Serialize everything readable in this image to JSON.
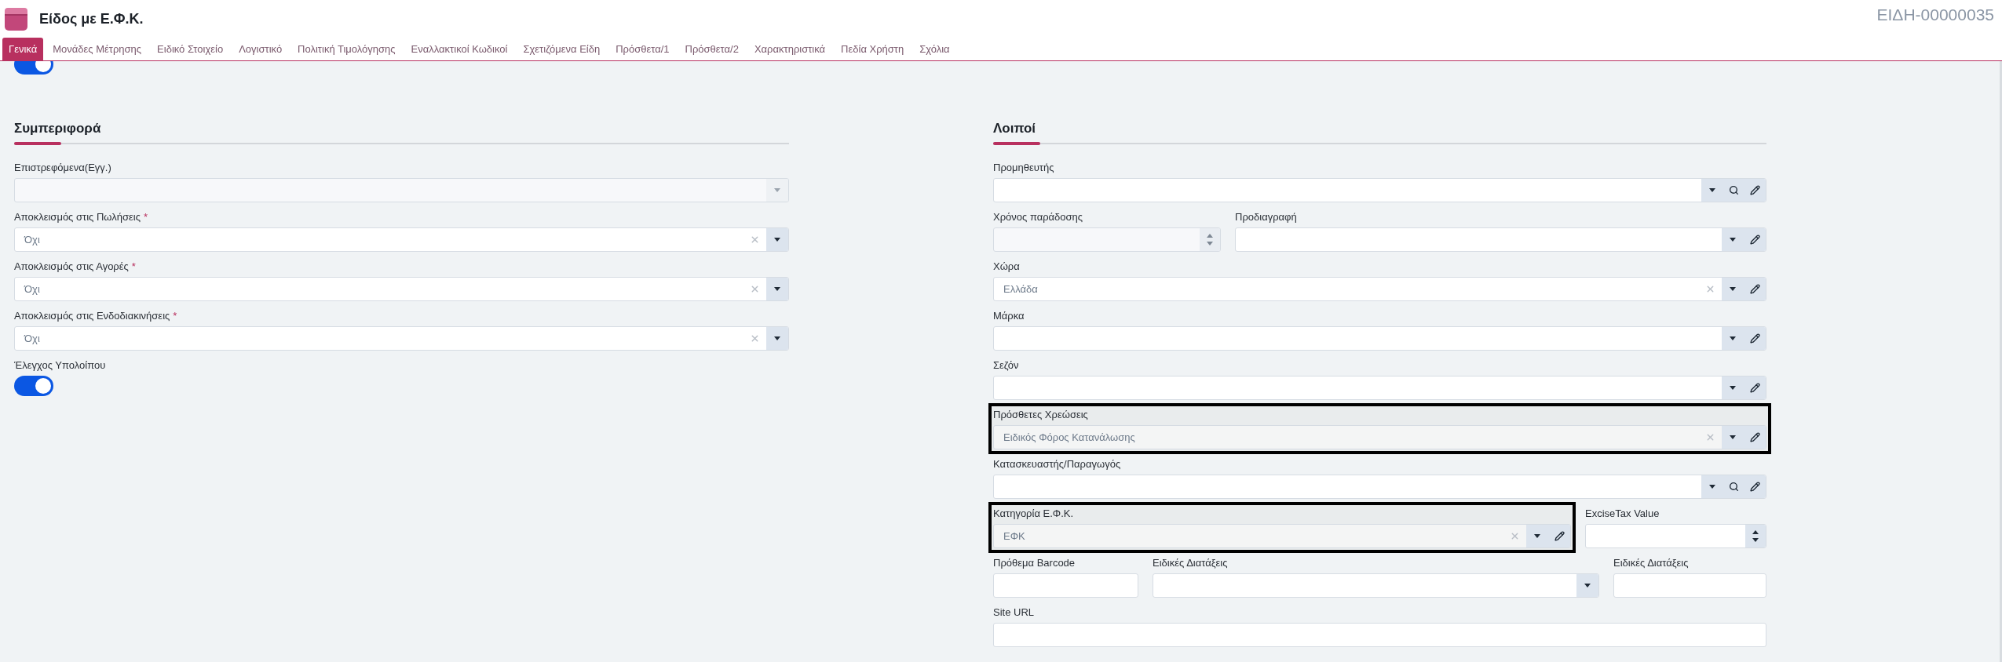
{
  "header": {
    "title": "Είδος με Ε.Φ.Κ.",
    "record_code": "ΕΙΔΗ-00000035"
  },
  "tabs": [
    {
      "label": "Γενικά",
      "selected": true
    },
    {
      "label": "Μονάδες Μέτρησης",
      "selected": false
    },
    {
      "label": "Ειδικό Στοιχείο",
      "selected": false
    },
    {
      "label": "Λογιστικό",
      "selected": false
    },
    {
      "label": "Πολιτική Τιμολόγησης",
      "selected": false
    },
    {
      "label": "Εναλλακτικοί Κωδικοί",
      "selected": false
    },
    {
      "label": "Σχετιζόμενα Είδη",
      "selected": false
    },
    {
      "label": "Πρόσθετα/1",
      "selected": false
    },
    {
      "label": "Πρόσθετα/2",
      "selected": false
    },
    {
      "label": "Χαρακτηριστικά",
      "selected": false
    },
    {
      "label": "Πεδία Χρήστη",
      "selected": false
    },
    {
      "label": "Σχόλια",
      "selected": false
    }
  ],
  "top_toggle": {
    "on": true
  },
  "left_section": {
    "title": "Συμπεριφορά",
    "fields": [
      {
        "kind": "select",
        "label": "Επιστρεφόμενα(Εγγ.)",
        "disabled": true
      },
      {
        "kind": "select",
        "label": "Αποκλεισμός στις Πωλήσεις",
        "required_mark": "*",
        "value": "Όχι",
        "clearable": true
      },
      {
        "kind": "select",
        "label": "Αποκλεισμός στις Αγορές",
        "required_mark": "*",
        "value": "Όχι",
        "clearable": true
      },
      {
        "kind": "select",
        "label": "Αποκλεισμός στις Ενδοδιακινήσεις",
        "required_mark": "*",
        "value": "Όχι",
        "clearable": true
      },
      {
        "kind": "toggle",
        "label": "Έλεγχος Υπολοίπου",
        "on": true
      }
    ]
  },
  "right_section": {
    "title": "Λοιποί",
    "rows": [
      {
        "fields": [
          {
            "kind": "select",
            "label": "Προμηθευτής",
            "search": true,
            "edit": true
          }
        ]
      },
      {
        "fields": [
          {
            "kind": "number",
            "label": "Χρόνος παράδοσης",
            "disabled": true
          },
          {
            "kind": "select",
            "label": "Προδιαγραφή",
            "edit": true
          }
        ]
      },
      {
        "fields": [
          {
            "kind": "select",
            "label": "Χώρα",
            "value": "Ελλάδα",
            "clearable": true,
            "edit": true
          }
        ]
      },
      {
        "fields": [
          {
            "kind": "select",
            "label": "Μάρκα",
            "edit": true
          }
        ]
      },
      {
        "fields": [
          {
            "kind": "select",
            "label": "Σεζόν",
            "edit": true
          }
        ]
      },
      {
        "fields": [
          {
            "kind": "select",
            "label": "Πρόσθετες Χρεώσεις",
            "value": "Ειδικός Φόρος Κατανάλωσης",
            "clearable": true,
            "edit": true,
            "highlighted": true
          }
        ]
      },
      {
        "fields": [
          {
            "kind": "select",
            "label": "Κατασκευαστής/Παραγωγός",
            "search": true,
            "edit": true
          }
        ]
      },
      {
        "fields": [
          {
            "kind": "select",
            "label": "Κατηγορία Ε.Φ.Κ.",
            "value": "ΕΦΚ",
            "clearable": true,
            "edit": true,
            "highlighted": true
          },
          {
            "kind": "number",
            "label": "ExciseTax Value"
          }
        ]
      },
      {
        "fields": [
          {
            "kind": "text",
            "label": "Πρόθεμα Barcode"
          },
          {
            "kind": "select",
            "label": "Ειδικές Διατάξεις"
          },
          {
            "kind": "text",
            "label": "Ειδικές Διατάξεις"
          }
        ]
      },
      {
        "fields": [
          {
            "kind": "text",
            "label": "Site URL"
          }
        ]
      }
    ]
  }
}
